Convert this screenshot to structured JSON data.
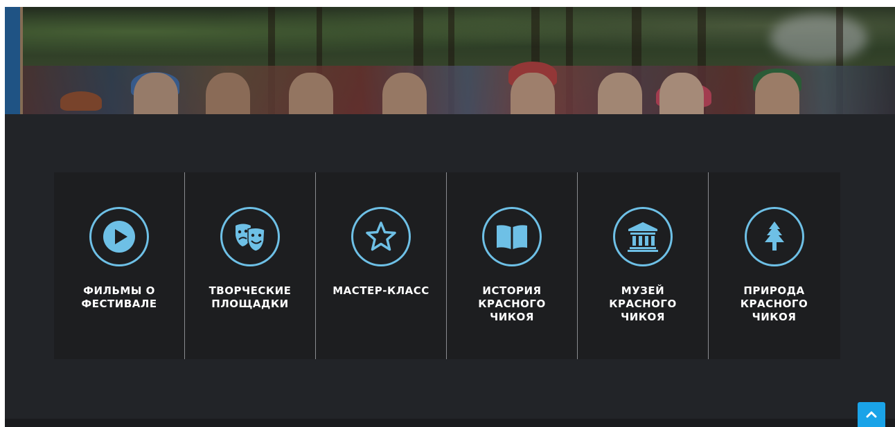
{
  "colors": {
    "background": "#222428",
    "tile": "#1d1e20",
    "icon": "#6ec0e6",
    "scroll_button": "#1aa3e8"
  },
  "tiles": [
    {
      "label": "ФИЛЬМЫ О\nФЕСТИВАЛЕ",
      "icon": "play-icon"
    },
    {
      "label": "ТВОРЧЕСКИЕ\nПЛОЩАДКИ",
      "icon": "theater-masks-icon"
    },
    {
      "label": "МАСТЕР-КЛАСС",
      "icon": "star-icon"
    },
    {
      "label": "ИСТОРИЯ\nКРАСНОГО\nЧИКОЯ",
      "icon": "open-book-icon"
    },
    {
      "label": "МУЗЕЙ\nКРАСНОГО\nЧИКОЯ",
      "icon": "museum-icon"
    },
    {
      "label": "ПРИРОДА\nКРАСНОГО\nЧИКОЯ",
      "icon": "tree-icon"
    }
  ],
  "scroll_top": {
    "icon": "chevron-up-icon"
  }
}
